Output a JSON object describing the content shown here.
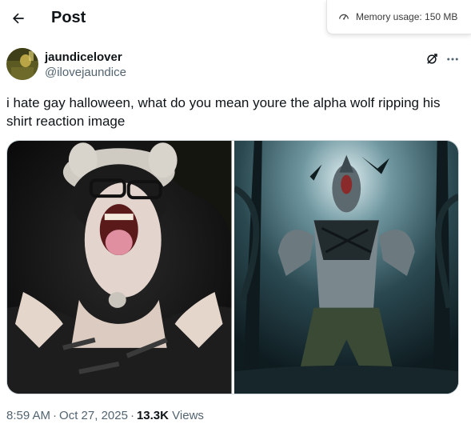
{
  "header": {
    "title": "Post",
    "back_icon": "arrow-left-icon"
  },
  "memory": {
    "label": "Memory usage: 150 MB",
    "icon": "gauge-icon"
  },
  "author": {
    "display_name": "jaundicelover",
    "handle": "@ilovejaundice",
    "grok_icon": "grok-icon",
    "more_icon": "more-dots-icon"
  },
  "tweet": {
    "text": "i hate gay halloween, what do you mean youre the alpha wolf ripping his shirt reaction image"
  },
  "media": {
    "images": [
      "photo-person-wolf-costume",
      "illustration-werewolf-howling"
    ]
  },
  "meta": {
    "time": "8:59 AM",
    "date": "Oct 27, 2025",
    "views_count": "13.3K",
    "views_label": "Views",
    "separator": "·"
  },
  "colors": {
    "text_primary": "#0f1419",
    "text_secondary": "#536471",
    "border": "#cfd9de"
  }
}
